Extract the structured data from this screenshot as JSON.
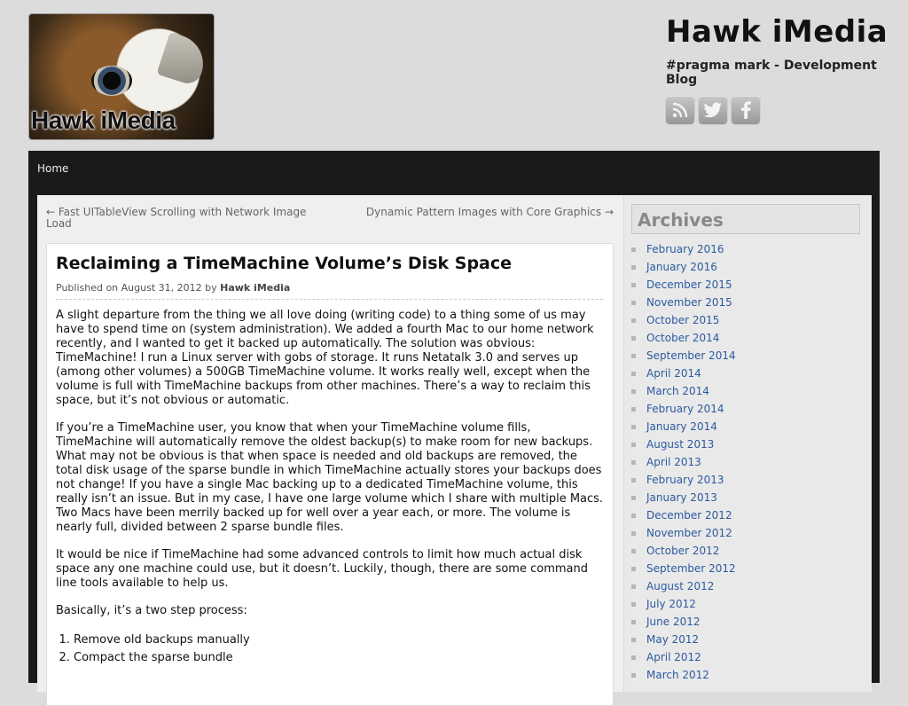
{
  "header": {
    "logo_text": "Hawk iMedia",
    "site_title": "Hawk iMedia",
    "tagline": "#pragma mark - Development Blog",
    "social": [
      {
        "icon": "rss-icon"
      },
      {
        "icon": "twitter-icon"
      },
      {
        "icon": "facebook-icon"
      }
    ]
  },
  "nav": {
    "home": "Home"
  },
  "post_nav": {
    "prev": "← Fast UITableView Scrolling with Network Image Load",
    "next": "Dynamic Pattern Images with Core Graphics →"
  },
  "post": {
    "title": "Reclaiming a TimeMachine Volume’s Disk Space",
    "meta_prefix": "Published on August 31, 2012 by",
    "author": "Hawk iMedia",
    "paragraphs": [
      "A slight departure from the thing we all love doing (writing code) to a thing some of us may have to spend time on (system administration). We added a fourth Mac to our home network recently, and I wanted to get it backed up automatically. The solution was obvious: TimeMachine! I run a Linux server with gobs of storage. It runs Netatalk 3.0 and serves up (among other volumes) a 500GB TimeMachine volume. It works really well, except when the volume is full with TimeMachine backups from other machines. There’s a way to reclaim this space, but it’s not obvious or automatic.",
      "If you’re a TimeMachine user, you know that when your TimeMachine volume fills, TimeMachine will automatically remove the oldest backup(s) to make room for new backups. What may not be obvious is that when space is needed and old backups are removed, the total disk usage of the sparse bundle in which TimeMachine actually stores your backups does not change! If you have a single Mac backing up to a dedicated TimeMachine volume, this really isn’t an issue. But in my case, I have one large volume which I share with multiple Macs. Two Macs have been merrily backed up for well over a year each, or more. The volume is nearly full, divided between 2 sparse bundle files.",
      "It would be nice if TimeMachine had some advanced controls to limit how much actual disk space any one machine could use, but it doesn’t. Luckily, though, there are some command line tools available to help us.",
      "Basically, it’s a two step process:"
    ],
    "steps": [
      "Remove old backups manually",
      "Compact the sparse bundle"
    ]
  },
  "sidebar": {
    "title": "Archives",
    "archives": [
      "February 2016",
      "January 2016",
      "December 2015",
      "November 2015",
      "October 2015",
      "October 2014",
      "September 2014",
      "April 2014",
      "March 2014",
      "February 2014",
      "January 2014",
      "August 2013",
      "April 2013",
      "February 2013",
      "January 2013",
      "December 2012",
      "November 2012",
      "October 2012",
      "September 2012",
      "August 2012",
      "July 2012",
      "June 2012",
      "May 2012",
      "April 2012",
      "March 2012"
    ]
  }
}
